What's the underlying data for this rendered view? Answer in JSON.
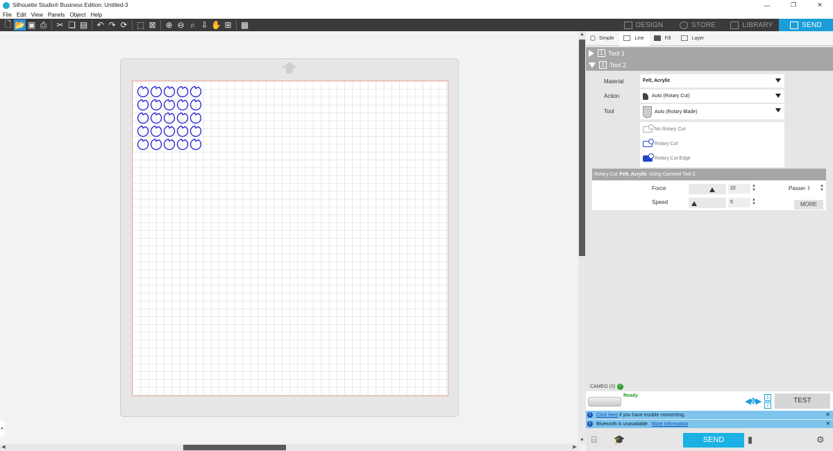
{
  "window": {
    "title": "Silhouette Studio® Business Edition: Untitled-3"
  },
  "menu": [
    "File",
    "Edit",
    "View",
    "Panels",
    "Object",
    "Help"
  ],
  "nav_tabs": [
    {
      "label": "DESIGN",
      "icon": "grid-icon",
      "active": false
    },
    {
      "label": "STORE",
      "icon": "store-icon",
      "active": false
    },
    {
      "label": "LIBRARY",
      "icon": "library-icon",
      "active": false
    },
    {
      "label": "SEND",
      "icon": "send-icon",
      "active": true
    }
  ],
  "toolbar_icons": [
    "new-icon",
    "open-icon",
    "save-icon",
    "print-icon",
    "cut-icon",
    "copy-icon",
    "paste-icon",
    "undo-icon",
    "redo-icon",
    "redraw-icon",
    "select-all-icon",
    "deselect-icon",
    "zoom-in-icon",
    "zoom-out-icon",
    "zoom-select-icon",
    "move-down-icon",
    "pan-hand-icon",
    "fit-page-icon",
    "pixel-grid-icon"
  ],
  "modes": [
    {
      "label": "Simple"
    },
    {
      "label": "Line"
    },
    {
      "label": "Fill"
    },
    {
      "label": "Layer"
    }
  ],
  "tools": [
    {
      "num": "1",
      "label": "Tool 1",
      "expanded": false
    },
    {
      "num": "2",
      "label": "Tool 2",
      "expanded": true
    }
  ],
  "tool_settings": {
    "material_label": "Material",
    "material_value": "Felt, Acrylic",
    "action_label": "Action",
    "action_value": "Auto (Rotary Cut)",
    "tool_label": "Tool",
    "tool_value": "Auto (Rotary Blade)"
  },
  "cut_options": [
    "No Rotary Cut",
    "Rotary Cut",
    "Rotary Cut Edge"
  ],
  "cut_settings": {
    "head_prefix": "Rotary Cut",
    "head_material": "Felt, Acrylic",
    "head_suffix": "Using Cameo4 Tool 2",
    "force_label": "Force",
    "force_value": "22",
    "speed_label": "Speed",
    "speed_value": "5",
    "passes_label": "Passes",
    "passes_value": "1",
    "more_label": "MORE"
  },
  "machine": {
    "name": "CAMEO (3)",
    "status": "Ready",
    "tool_slots": [
      "1",
      "2"
    ],
    "test_label": "TEST"
  },
  "notices": [
    {
      "link": "Click here",
      "text": " if you have trouble connecting."
    },
    {
      "text": "Bluetooth is unavailable.",
      "link": "More information"
    }
  ],
  "send_label": "SEND",
  "design": {
    "grid_rows": 5,
    "grid_cols": 5,
    "shape": "circle-with-notch",
    "color": "#1a1ad6"
  },
  "colors": {
    "accent": "#1b9ed8",
    "toolbar_bg": "#3a3a3a",
    "panel_bg": "#e6e6e6",
    "ready": "#1f9e1f"
  }
}
